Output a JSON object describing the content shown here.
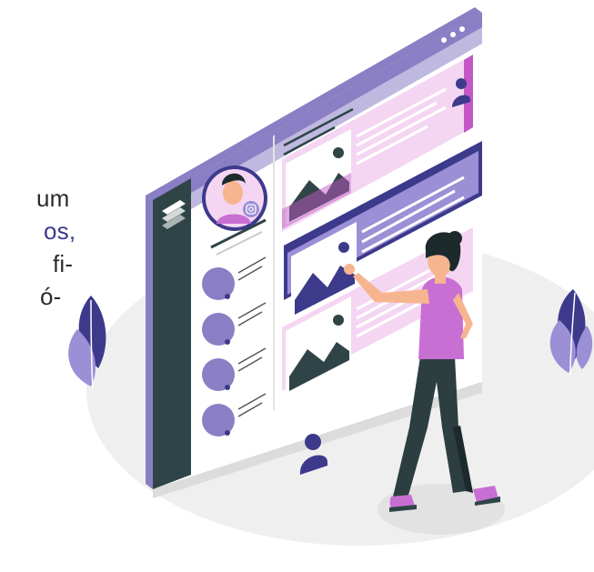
{
  "text_fragments": [
    "um",
    "os,",
    "fi-",
    "ó-"
  ],
  "colors": {
    "panel_frame": "#8a7fc4",
    "panel_face": "#ffffff",
    "sidebar_dark": "#2f4447",
    "accent_purple": "#3d3a8c",
    "lilac": "#9b8fd6",
    "pink": "#f4d6f2",
    "magenta": "#c457c8",
    "ground": "#efefef",
    "skin": "#f6b58f",
    "shirt": "#c86fd4",
    "pants": "#2c3e40",
    "hair": "#1c2a2c"
  },
  "icons": {
    "app_logo": "stacked-layers-icon",
    "window_controls": "three-dots-icon",
    "image_placeholder": "mountain-image-icon",
    "user": "user-silhouette-icon",
    "instagram": "instagram-icon",
    "plant": "leaf-plant-icon"
  }
}
